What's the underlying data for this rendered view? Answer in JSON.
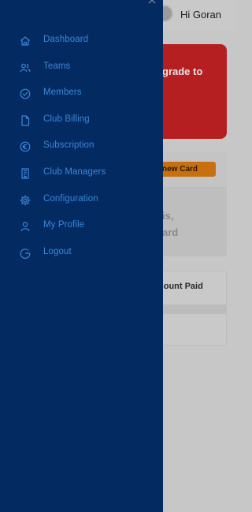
{
  "header": {
    "greeting": "Hi Goran"
  },
  "background": {
    "upgrade_text": "grade to",
    "add_card_label": "new Card",
    "info_line1": "is,",
    "info_line2": "ard",
    "amount_header": "nount Paid"
  },
  "drawer": {
    "close_icon": "close-icon",
    "items": [
      {
        "label": "Dashboard",
        "icon": "home-icon"
      },
      {
        "label": "Teams",
        "icon": "users-icon"
      },
      {
        "label": "Members",
        "icon": "check-circle-icon"
      },
      {
        "label": "Club Billing",
        "icon": "document-icon"
      },
      {
        "label": "Subscription",
        "icon": "euro-icon"
      },
      {
        "label": "Club Managers",
        "icon": "building-icon"
      },
      {
        "label": "Configuration",
        "icon": "gear-icon"
      },
      {
        "label": "My Profile",
        "icon": "user-icon"
      },
      {
        "label": "Logout",
        "icon": "logout-icon"
      }
    ]
  },
  "colors": {
    "drawer_bg": "#032b61",
    "nav_text": "#3a86d8",
    "alert_red": "#b61f22",
    "button_orange": "#c8700f",
    "overlay_gray": "#c7c7c7"
  }
}
